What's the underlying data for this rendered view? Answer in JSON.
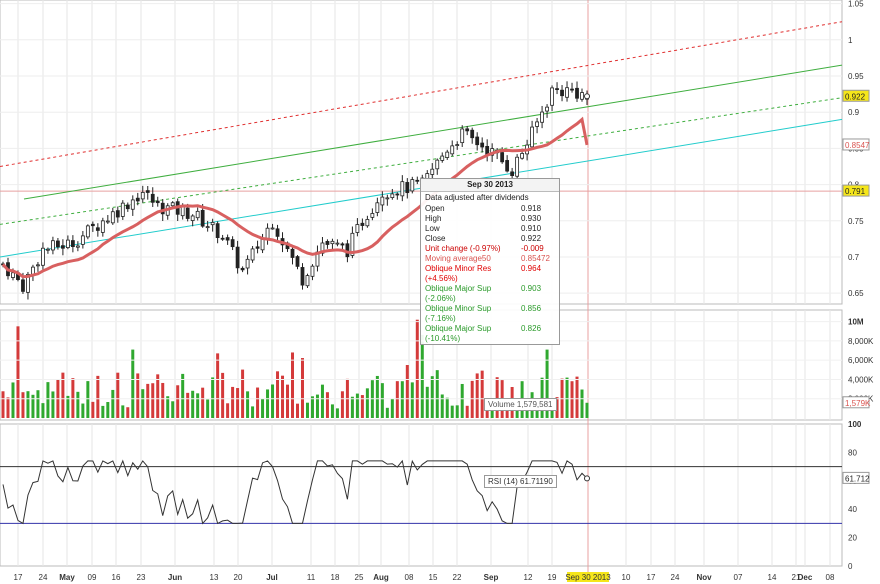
{
  "price_axis": [
    "1.05",
    "1",
    "0.95",
    "0.9",
    "0.85",
    "0.8",
    "0.75",
    "0.7",
    "0.65"
  ],
  "volume_axis": [
    "10M",
    "8,000K",
    "6,000K",
    "4,000K",
    "2,000K"
  ],
  "rsi_axis": [
    "100",
    "80",
    "60",
    "40",
    "20",
    "0"
  ],
  "x_axis": [
    "17",
    "24",
    "May",
    "09",
    "16",
    "23",
    "Jun",
    "13",
    "20",
    "Jul",
    "11",
    "18",
    "25",
    "Aug",
    "08",
    "15",
    "22",
    "Sep",
    "12",
    "19",
    "Sep 30 2013",
    "10",
    "17",
    "24",
    "Nov",
    "07",
    "14",
    "21",
    "Dec",
    "08"
  ],
  "badges": {
    "price": "0.922",
    "ma": "0.8547",
    "hline": "0.791",
    "volume": "1,579K",
    "rsi": "61.712"
  },
  "tooltip": {
    "date": "Sep 30 2013",
    "note": "Data adjusted after dividends",
    "rows": [
      {
        "label": "Open",
        "value": "0.918",
        "color": "#222222"
      },
      {
        "label": "High",
        "value": "0.930",
        "color": "#222222"
      },
      {
        "label": "Low",
        "value": "0.910",
        "color": "#222222"
      },
      {
        "label": "Close",
        "value": "0.922",
        "color": "#222222"
      },
      {
        "label": "Unit change (-0.97%)",
        "value": "-0.009",
        "color": "#cc0000"
      },
      {
        "label": "Moving average50",
        "value": "0.85472",
        "color": "#d9534f"
      },
      {
        "label": "Oblique Minor Res (+4.56%)",
        "value": "0.964",
        "color": "#e00000"
      },
      {
        "label": "Oblique Major Sup (-2.06%)",
        "value": "0.903",
        "color": "#2a9a2a"
      },
      {
        "label": "Oblique Minor Sup (-7.16%)",
        "value": "0.856",
        "color": "#2a9a2a"
      },
      {
        "label": "Oblique Major Sup (-10.41%)",
        "value": "0.826",
        "color": "#2a9a2a"
      }
    ]
  },
  "volume_label": "Volume 1,579,581",
  "rsi_label": "RSI (14)  61.71190",
  "chart_data": {
    "type": "candlestick",
    "price_range": [
      0.635,
      1.055
    ],
    "volume_range": [
      0,
      11000000
    ],
    "rsi_range": [
      0,
      100
    ],
    "rsi_levels": [
      70,
      30
    ],
    "horizontal_line": 0.791,
    "ma_period": 50,
    "last_bar": {
      "date": "Sep 30 2013",
      "open": 0.918,
      "high": 0.93,
      "low": 0.91,
      "close": 0.922,
      "volume": 1579581,
      "ma50": 0.85472,
      "rsi": 61.7119
    },
    "trendlines": [
      {
        "name": "Oblique Minor Res",
        "color": "#e03030",
        "dashed": true,
        "start": 0.825,
        "end": 1.025
      },
      {
        "name": "Oblique Major Sup",
        "color": "#3fae3f",
        "dashed": false,
        "start": 0.78,
        "end": 0.965
      },
      {
        "name": "Oblique Minor Sup",
        "color": "#3fae3f",
        "dashed": true,
        "start": 0.745,
        "end": 0.92
      },
      {
        "name": "Oblique Major Sup",
        "color": "#22cccc",
        "dashed": false,
        "start": 0.7,
        "end": 0.89
      }
    ],
    "colors": {
      "up": "#2fa82f",
      "down": "#d43a3a",
      "ma": "#d86060",
      "rsi": "#333333",
      "rsi_band": "#3333aa",
      "hline": "#e8a0a0"
    }
  }
}
